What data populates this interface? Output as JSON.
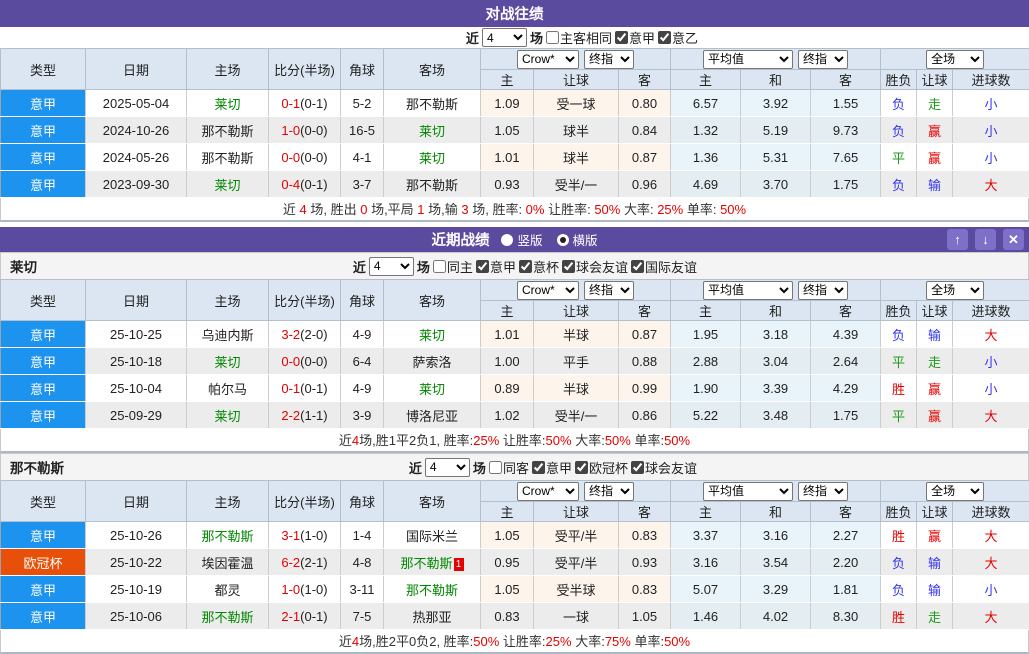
{
  "labels": {
    "near": "近",
    "games": "场"
  },
  "colors": {
    "titlebar_purple": "#5b4b9e",
    "button_purple": "#7e6fc8",
    "header_bg": "#dce6f2",
    "serie_a_badge": "#1d93f0",
    "ucl_badge": "#e8500a",
    "self_team_green": "#008800",
    "win_red": "#e60000",
    "lose_blue": "#3333ee",
    "draw_green": "#1d9a1d",
    "avg_col_bg": "#e8f4f9",
    "odds_col_bg": "#fdf4ec"
  },
  "headers": {
    "type": "类型",
    "date": "日期",
    "home": "主场",
    "score": "比分(半场)",
    "corners": "角球",
    "away": "客场",
    "odds_selects": [
      "Crow*",
      "终指"
    ],
    "odds_cols": [
      "主",
      "让球",
      "客"
    ],
    "avg_selects": [
      "平均值",
      "终指"
    ],
    "avg_cols": [
      "主",
      "和",
      "客"
    ],
    "full_select": "全场",
    "result_cols": [
      "胜负",
      "让球",
      "进球数"
    ]
  },
  "league_colors": {
    "意甲": "#1d93f0",
    "欧冠杯": "#e8500a"
  },
  "h2h": {
    "title": "对战往绩",
    "filter": {
      "rounds": "4",
      "venue_label": "主客相同",
      "venue_checked": false,
      "leagues": [
        {
          "label": "意甲",
          "checked": true
        },
        {
          "label": "意乙",
          "checked": true
        }
      ]
    },
    "rows": [
      {
        "league": "意甲",
        "date": "2025-05-04",
        "home": "莱切",
        "home_self": true,
        "score": "0-1",
        "half": "(0-1)",
        "corners": "5-2",
        "away": "那不勒斯",
        "away_self": false,
        "away_redcard": "",
        "odds": [
          "1.09",
          "受一球",
          "0.80"
        ],
        "avg": [
          "6.57",
          "3.92",
          "1.55"
        ],
        "results": [
          [
            "负",
            "lose"
          ],
          [
            "走",
            "draw"
          ],
          [
            "小",
            "lose"
          ]
        ]
      },
      {
        "league": "意甲",
        "date": "2024-10-26",
        "home": "那不勒斯",
        "home_self": false,
        "score": "1-0",
        "half": "(0-0)",
        "corners": "16-5",
        "away": "莱切",
        "away_self": true,
        "away_redcard": "",
        "odds": [
          "1.05",
          "球半",
          "0.84"
        ],
        "avg": [
          "1.32",
          "5.19",
          "9.73"
        ],
        "results": [
          [
            "负",
            "lose"
          ],
          [
            "赢",
            "win"
          ],
          [
            "小",
            "lose"
          ]
        ]
      },
      {
        "league": "意甲",
        "date": "2024-05-26",
        "home": "那不勒斯",
        "home_self": false,
        "score": "0-0",
        "half": "(0-0)",
        "corners": "4-1",
        "away": "莱切",
        "away_self": true,
        "away_redcard": "",
        "odds": [
          "1.01",
          "球半",
          "0.87"
        ],
        "avg": [
          "1.36",
          "5.31",
          "7.65"
        ],
        "results": [
          [
            "平",
            "draw"
          ],
          [
            "赢",
            "win"
          ],
          [
            "小",
            "lose"
          ]
        ]
      },
      {
        "league": "意甲",
        "date": "2023-09-30",
        "home": "莱切",
        "home_self": true,
        "score": "0-4",
        "half": "(0-1)",
        "corners": "3-7",
        "away": "那不勒斯",
        "away_self": false,
        "away_redcard": "",
        "odds": [
          "0.93",
          "受半/一",
          "0.96"
        ],
        "avg": [
          "4.69",
          "3.70",
          "1.75"
        ],
        "results": [
          [
            "负",
            "lose"
          ],
          [
            "输",
            "lose"
          ],
          [
            "大",
            "win"
          ]
        ]
      }
    ],
    "summary": [
      [
        "近 ",
        0
      ],
      [
        "4",
        1
      ],
      [
        " 场, 胜出 ",
        0
      ],
      [
        "0",
        1
      ],
      [
        " 场,平局 ",
        0
      ],
      [
        "1",
        1
      ],
      [
        " 场,输 ",
        0
      ],
      [
        "3",
        1
      ],
      [
        " 场, 胜率: ",
        0
      ],
      [
        "0%",
        1
      ],
      [
        " 让胜率: ",
        0
      ],
      [
        "50%",
        1
      ],
      [
        " 大率: ",
        0
      ],
      [
        "25%",
        1
      ],
      [
        " 单率: ",
        0
      ],
      [
        "50%",
        1
      ]
    ]
  },
  "recent": {
    "title": "近期战绩",
    "view_options": [
      {
        "label": "竖版",
        "selected": false
      },
      {
        "label": "横版",
        "selected": true
      }
    ],
    "window_buttons": {
      "up": "↑",
      "down": "↓",
      "close": "✕"
    },
    "teams": [
      {
        "name": "莱切",
        "filter": {
          "rounds": "4",
          "venue_label": "同主",
          "venue_checked": false,
          "leagues": [
            {
              "label": "意甲",
              "checked": true
            },
            {
              "label": "意杯",
              "checked": true
            },
            {
              "label": "球会友谊",
              "checked": true
            },
            {
              "label": "国际友谊",
              "checked": true
            }
          ]
        },
        "rows": [
          {
            "league": "意甲",
            "date": "25-10-25",
            "home": "乌迪内斯",
            "home_self": false,
            "score": "3-2",
            "half": "(2-0)",
            "corners": "4-9",
            "away": "莱切",
            "away_self": true,
            "away_redcard": "",
            "odds": [
              "1.01",
              "半球",
              "0.87"
            ],
            "avg": [
              "1.95",
              "3.18",
              "4.39"
            ],
            "results": [
              [
                "负",
                "lose"
              ],
              [
                "输",
                "lose"
              ],
              [
                "大",
                "win"
              ]
            ]
          },
          {
            "league": "意甲",
            "date": "25-10-18",
            "home": "莱切",
            "home_self": true,
            "score": "0-0",
            "half": "(0-0)",
            "corners": "6-4",
            "away": "萨索洛",
            "away_self": false,
            "away_redcard": "",
            "odds": [
              "1.00",
              "平手",
              "0.88"
            ],
            "avg": [
              "2.88",
              "3.04",
              "2.64"
            ],
            "results": [
              [
                "平",
                "draw"
              ],
              [
                "走",
                "draw"
              ],
              [
                "小",
                "lose"
              ]
            ]
          },
          {
            "league": "意甲",
            "date": "25-10-04",
            "home": "帕尔马",
            "home_self": false,
            "score": "0-1",
            "half": "(0-1)",
            "corners": "4-9",
            "away": "莱切",
            "away_self": true,
            "away_redcard": "",
            "odds": [
              "0.89",
              "半球",
              "0.99"
            ],
            "avg": [
              "1.90",
              "3.39",
              "4.29"
            ],
            "results": [
              [
                "胜",
                "win"
              ],
              [
                "赢",
                "win"
              ],
              [
                "小",
                "lose"
              ]
            ]
          },
          {
            "league": "意甲",
            "date": "25-09-29",
            "home": "莱切",
            "home_self": true,
            "score": "2-2",
            "half": "(1-1)",
            "corners": "3-9",
            "away": "博洛尼亚",
            "away_self": false,
            "away_redcard": "",
            "odds": [
              "1.02",
              "受半/一",
              "0.86"
            ],
            "avg": [
              "5.22",
              "3.48",
              "1.75"
            ],
            "results": [
              [
                "平",
                "draw"
              ],
              [
                "赢",
                "win"
              ],
              [
                "大",
                "win"
              ]
            ]
          }
        ],
        "summary": [
          [
            "近",
            0
          ],
          [
            "4",
            1
          ],
          [
            "场,胜1平2负1, 胜率:",
            0
          ],
          [
            "25%",
            1
          ],
          [
            " 让胜率:",
            0
          ],
          [
            "50%",
            1
          ],
          [
            " 大率:",
            0
          ],
          [
            "50%",
            1
          ],
          [
            " 单率:",
            0
          ],
          [
            "50%",
            1
          ]
        ]
      },
      {
        "name": "那不勒斯",
        "filter": {
          "rounds": "4",
          "venue_label": "同客",
          "venue_checked": false,
          "leagues": [
            {
              "label": "意甲",
              "checked": true
            },
            {
              "label": "欧冠杯",
              "checked": true
            },
            {
              "label": "球会友谊",
              "checked": true
            }
          ]
        },
        "rows": [
          {
            "league": "意甲",
            "date": "25-10-26",
            "home": "那不勒斯",
            "home_self": true,
            "score": "3-1",
            "half": "(1-0)",
            "corners": "1-4",
            "away": "国际米兰",
            "away_self": false,
            "away_redcard": "",
            "odds": [
              "1.05",
              "受平/半",
              "0.83"
            ],
            "avg": [
              "3.37",
              "3.16",
              "2.27"
            ],
            "results": [
              [
                "胜",
                "win"
              ],
              [
                "赢",
                "win"
              ],
              [
                "大",
                "win"
              ]
            ]
          },
          {
            "league": "欧冠杯",
            "date": "25-10-22",
            "home": "埃因霍温",
            "home_self": false,
            "score": "6-2",
            "half": "(2-1)",
            "corners": "4-8",
            "away": "那不勒斯",
            "away_self": true,
            "away_redcard": "1",
            "odds": [
              "0.95",
              "受平/半",
              "0.93"
            ],
            "avg": [
              "3.16",
              "3.54",
              "2.20"
            ],
            "results": [
              [
                "负",
                "lose"
              ],
              [
                "输",
                "lose"
              ],
              [
                "大",
                "win"
              ]
            ]
          },
          {
            "league": "意甲",
            "date": "25-10-19",
            "home": "都灵",
            "home_self": false,
            "score": "1-0",
            "half": "(1-0)",
            "corners": "3-11",
            "away": "那不勒斯",
            "away_self": true,
            "away_redcard": "",
            "odds": [
              "1.05",
              "受半球",
              "0.83"
            ],
            "avg": [
              "5.07",
              "3.29",
              "1.81"
            ],
            "results": [
              [
                "负",
                "lose"
              ],
              [
                "输",
                "lose"
              ],
              [
                "小",
                "lose"
              ]
            ]
          },
          {
            "league": "意甲",
            "date": "25-10-06",
            "home": "那不勒斯",
            "home_self": true,
            "score": "2-1",
            "half": "(0-1)",
            "corners": "7-5",
            "away": "热那亚",
            "away_self": false,
            "away_redcard": "",
            "odds": [
              "0.83",
              "一球",
              "1.05"
            ],
            "avg": [
              "1.46",
              "4.02",
              "8.30"
            ],
            "results": [
              [
                "胜",
                "win"
              ],
              [
                "走",
                "draw"
              ],
              [
                "大",
                "win"
              ]
            ]
          }
        ],
        "summary": [
          [
            "近",
            0
          ],
          [
            "4",
            1
          ],
          [
            "场,胜2平0负2, 胜率:",
            0
          ],
          [
            "50%",
            1
          ],
          [
            " 让胜率:",
            0
          ],
          [
            "25%",
            1
          ],
          [
            " 大率:",
            0
          ],
          [
            "75%",
            1
          ],
          [
            " 单率:",
            0
          ],
          [
            "50%",
            1
          ]
        ]
      }
    ]
  }
}
